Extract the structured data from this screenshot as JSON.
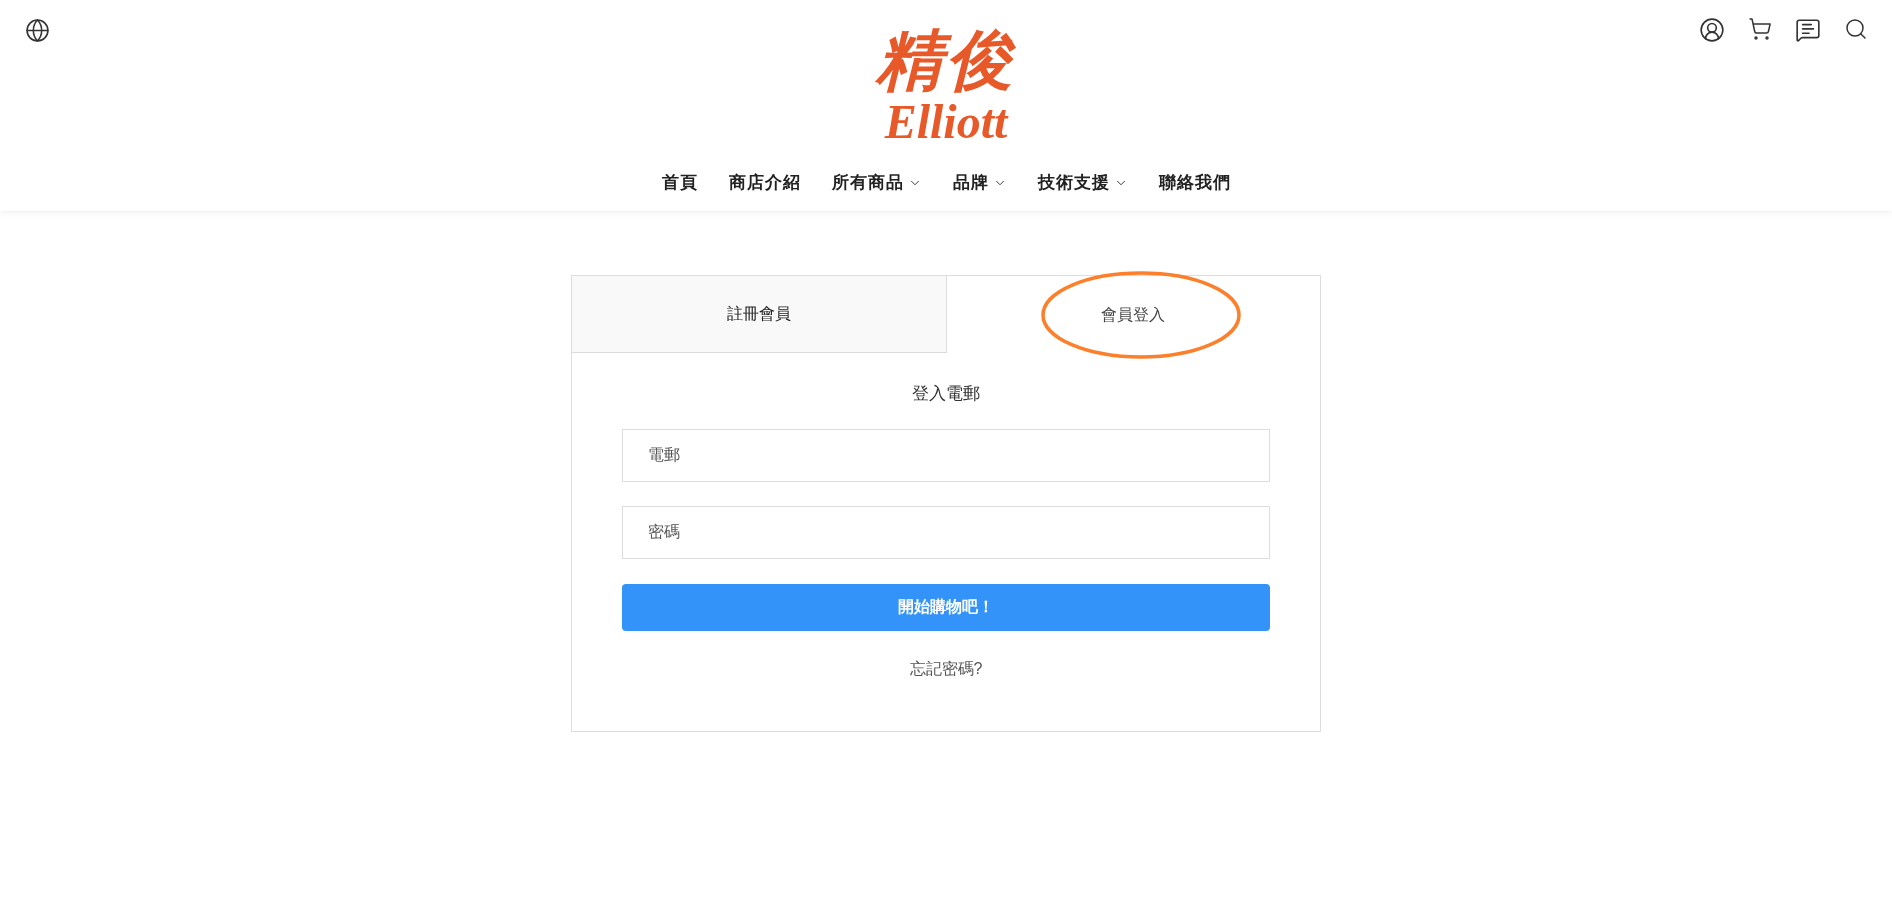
{
  "header": {
    "logo": {
      "chinese": "精俊",
      "latin": "Elliott"
    },
    "nav": [
      {
        "label": "首頁",
        "has_dropdown": false
      },
      {
        "label": "商店介紹",
        "has_dropdown": false
      },
      {
        "label": "所有商品",
        "has_dropdown": true
      },
      {
        "label": "品牌",
        "has_dropdown": true
      },
      {
        "label": "技術支援",
        "has_dropdown": true
      },
      {
        "label": "聯絡我們",
        "has_dropdown": false
      }
    ]
  },
  "tabs": [
    {
      "label": "註冊會員",
      "selected": false,
      "circled": false
    },
    {
      "label": "會員登入",
      "selected": true,
      "circled": true
    }
  ],
  "form": {
    "title": "登入電郵",
    "email": {
      "placeholder": "電郵"
    },
    "password": {
      "placeholder": "密碼"
    },
    "submit": "開始購物吧！",
    "forgot": "忘記密碼?"
  }
}
